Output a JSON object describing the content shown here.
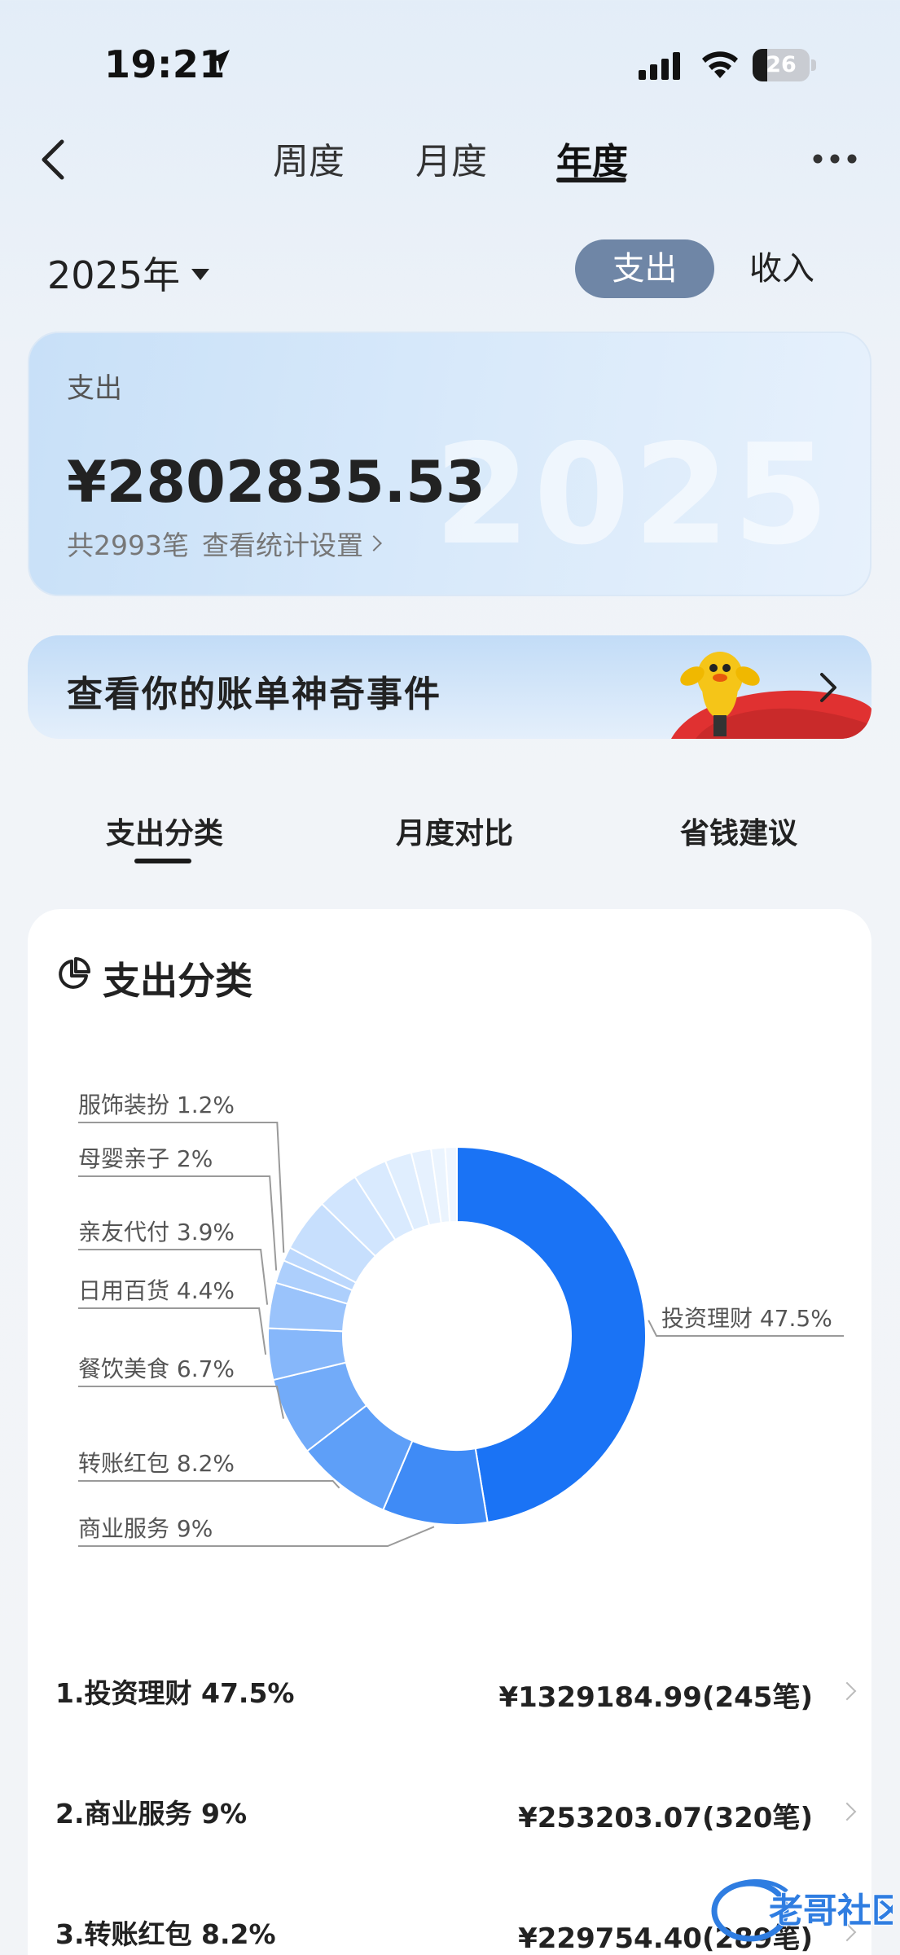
{
  "status_bar": {
    "time": "19:21",
    "battery_level": 26,
    "battery_label": "26"
  },
  "nav": {
    "tabs": [
      {
        "label": "周度",
        "active": false
      },
      {
        "label": "月度",
        "active": false
      },
      {
        "label": "年度",
        "active": true
      }
    ]
  },
  "filter": {
    "year_label": "2025年",
    "toggle_expense": "支出",
    "toggle_income": "收入",
    "selected": "支出"
  },
  "summary": {
    "label": "支出",
    "amount": "¥2802835.53",
    "count_text": "共2993笔",
    "settings_link": "查看统计设置",
    "watermark_year": "2025"
  },
  "banner": {
    "text": "查看你的账单神奇事件"
  },
  "section_tabs": [
    {
      "label": "支出分类",
      "active": true
    },
    {
      "label": "月度对比",
      "active": false
    },
    {
      "label": "省钱建议",
      "active": false
    }
  ],
  "category_card": {
    "title": "支出分类"
  },
  "chart_data": {
    "type": "pie",
    "variant": "donut",
    "labeled_slices": [
      {
        "label": "投资理财 47.5%",
        "name": "投资理财",
        "value": 47.5
      },
      {
        "label": "商业服务 9%",
        "name": "商业服务",
        "value": 9
      },
      {
        "label": "转账红包 8.2%",
        "name": "转账红包",
        "value": 8.2
      },
      {
        "label": "餐饮美食 6.7%",
        "name": "餐饮美食",
        "value": 6.7
      },
      {
        "label": "日用百货 4.4%",
        "name": "日用百货",
        "value": 4.4
      },
      {
        "label": "亲友代付 3.9%",
        "name": "亲友代付",
        "value": 3.9
      },
      {
        "label": "母婴亲子 2%",
        "name": "母婴亲子",
        "value": 2
      },
      {
        "label": "服饰装扮 1.2%",
        "name": "服饰装扮",
        "value": 1.2
      }
    ],
    "unlabeled_slices": [
      4.6,
      3.6,
      2.9,
      2.3,
      1.7,
      1.2,
      1.0
    ],
    "colors": [
      "#1a73f5",
      "#3f8bf6",
      "#5e9ff8",
      "#72abf9",
      "#86b7fa",
      "#9ac3fb",
      "#adcffc",
      "#bcd8fd",
      "#c7dffd",
      "#d1e5fe",
      "#d9eafe",
      "#e0eefe",
      "#e6f1fe",
      "#ebf4fe",
      "#eff6ff"
    ]
  },
  "category_list": [
    {
      "name": "1.投资理财 47.5%",
      "value": "¥1329184.99(245笔)"
    },
    {
      "name": "2.商业服务 9%",
      "value": "¥253203.07(320笔)"
    },
    {
      "name": "3.转账红包 8.2%",
      "value": "¥229754.40(289笔)"
    }
  ],
  "watermark": {
    "text": "老哥社区"
  }
}
